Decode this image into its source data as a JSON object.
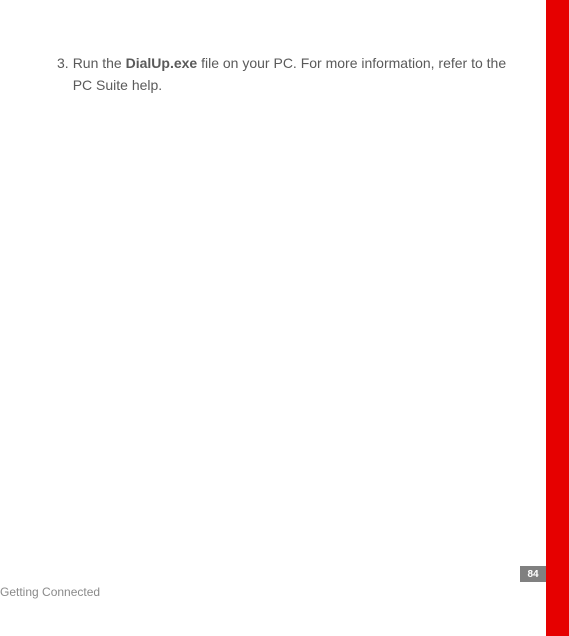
{
  "content": {
    "list_marker": "3.",
    "text_before": "Run the ",
    "bold_text": "DialUp.exe",
    "text_after": " file on your PC. For more information, refer to the PC Suite help."
  },
  "page_number": "84",
  "footer": "Getting Connected"
}
